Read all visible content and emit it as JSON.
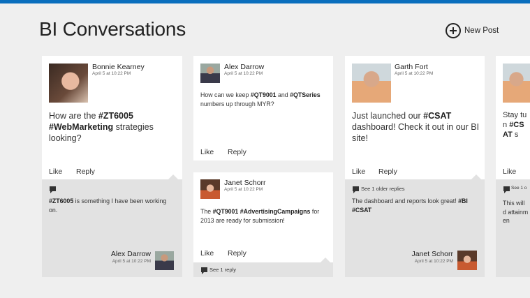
{
  "app": {
    "title": "BI Conversations",
    "new_post": "New Post",
    "accent": "#0a6ebd"
  },
  "actions": {
    "like": "Like",
    "reply": "Reply"
  },
  "posts": [
    {
      "author": "Bonnie Kearney",
      "date": "April 5 at 10:22 PM",
      "text_parts": [
        "How are the ",
        "#ZT6005",
        " ",
        "#WebMarketing",
        " strategies looking?"
      ],
      "reply": {
        "author": "Alex Darrow",
        "date": "April 5 at 10:22 PM",
        "text_parts": [
          "#ZT6005",
          " is something I have been working on."
        ]
      }
    },
    {
      "author": "Alex Darrow",
      "date": "April 5 at 10:22 PM",
      "text_parts": [
        "How can we keep ",
        "#QT9001",
        " and ",
        "#QTSeries",
        " numbers up through MYR?"
      ]
    },
    {
      "author": "Janet Schorr",
      "date": "April 5 at 10:22 PM",
      "text_parts": [
        "The ",
        "#QT9001",
        " ",
        "#AdvertisingCampaigns",
        " for 2013 are ready for submission!"
      ],
      "see_replies": "See 1 reply"
    },
    {
      "author": "Garth Fort",
      "date": "April 5 at 10:22 PM",
      "text_parts": [
        "Just launched our ",
        "#CSAT",
        " dashboard! Check it out in our BI site!"
      ],
      "see_replies": "See 1 older replies",
      "reply": {
        "author": "Janet Schorr",
        "date": "April 5 at 10:22 PM",
        "text_parts": [
          "The dashboard and reports look great! ",
          "#BI",
          " ",
          "#CSAT"
        ]
      }
    },
    {
      "text_parts": [
        "Stay tun",
        "#CSAT",
        " s"
      ],
      "see_replies": "See 1 o",
      "reply": {
        "text": "This will d attainmen"
      }
    }
  ]
}
